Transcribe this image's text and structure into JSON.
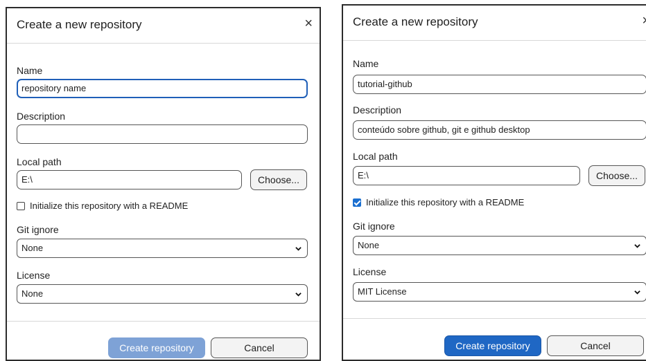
{
  "left_dialog": {
    "title": "Create a new repository",
    "close_glyph": "×",
    "name_label": "Name",
    "name_value": "repository name",
    "description_label": "Description",
    "description_value": "",
    "local_path_label": "Local path",
    "local_path_value": "E:\\",
    "choose_label": "Choose...",
    "readme_label": "Initialize this repository with a README",
    "readme_checked": false,
    "gitignore_label": "Git ignore",
    "gitignore_value": "None",
    "license_label": "License",
    "license_value": "None",
    "create_label": "Create repository",
    "cancel_label": "Cancel",
    "create_color": "#7ea2d6"
  },
  "right_dialog": {
    "title": "Create a new repository",
    "close_glyph": "×",
    "name_label": "Name",
    "name_value": "tutorial-github",
    "description_label": "Description",
    "description_value": "conteúdo sobre github, git e github desktop",
    "local_path_label": "Local path",
    "local_path_value": "E:\\",
    "choose_label": "Choose...",
    "readme_label": "Initialize this repository with a README",
    "readme_checked": true,
    "gitignore_label": "Git ignore",
    "gitignore_value": "None",
    "license_label": "License",
    "license_value": "MIT License",
    "create_label": "Create repository",
    "cancel_label": "Cancel",
    "create_color": "#1f67c4"
  },
  "icons": {
    "close": "close-icon",
    "chevron": "chevron-down-icon",
    "checkbox": "checkbox-icon"
  }
}
